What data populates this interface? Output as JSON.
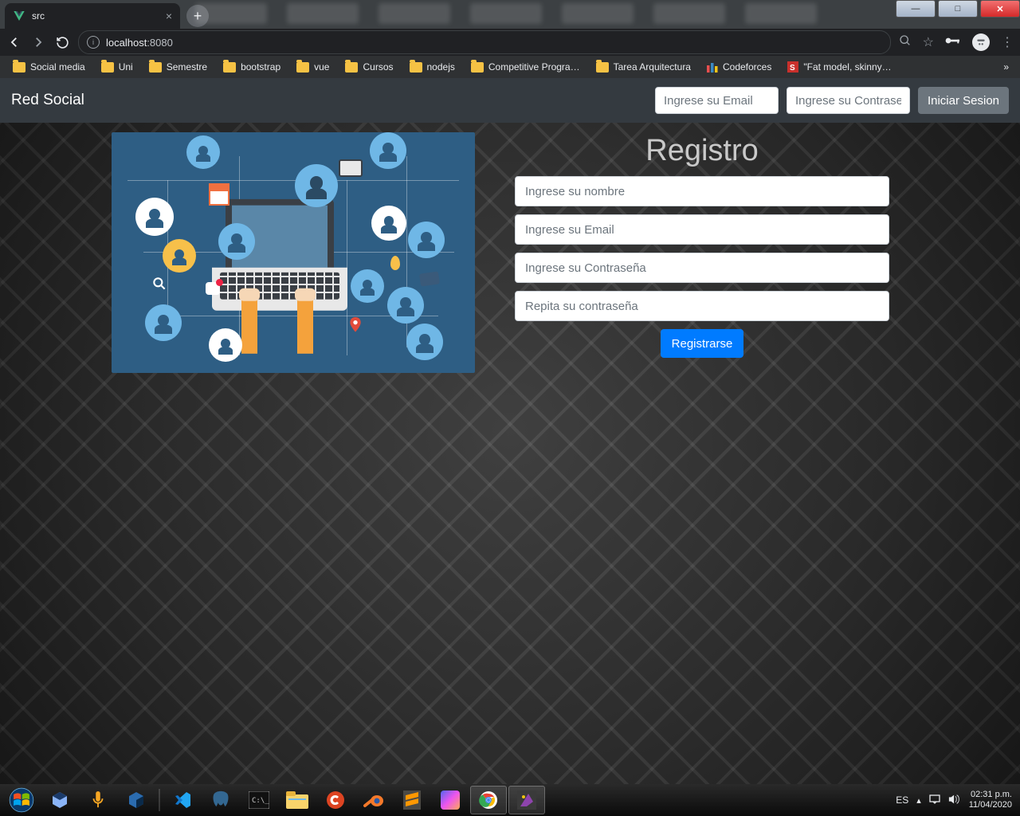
{
  "window_controls": {
    "min": "—",
    "max": "□",
    "close": "✕"
  },
  "browser": {
    "tab_title": "src",
    "url_host": "localhost",
    "url_port": ":8080",
    "bookmarks": [
      {
        "label": "Social media",
        "type": "folder"
      },
      {
        "label": "Uni",
        "type": "folder"
      },
      {
        "label": "Semestre",
        "type": "folder"
      },
      {
        "label": "bootstrap",
        "type": "folder"
      },
      {
        "label": "vue",
        "type": "folder"
      },
      {
        "label": "Cursos",
        "type": "folder"
      },
      {
        "label": "nodejs",
        "type": "folder"
      },
      {
        "label": "Competitive Progra…",
        "type": "folder"
      },
      {
        "label": "Tarea Arquitectura",
        "type": "folder"
      },
      {
        "label": "Codeforces",
        "type": "cf"
      },
      {
        "label": "\"Fat model, skinny…",
        "type": "so"
      }
    ]
  },
  "app": {
    "brand": "Red Social",
    "login": {
      "email_placeholder": "Ingrese su Email",
      "password_placeholder": "Ingrese su Contraseña",
      "submit_label": "Iniciar Sesion"
    },
    "register": {
      "title": "Registro",
      "name_placeholder": "Ingrese su nombre",
      "email_placeholder": "Ingrese su Email",
      "password_placeholder": "Ingrese su Contraseña",
      "repeat_placeholder": "Repita su contraseña",
      "submit_label": "Registrarse"
    }
  },
  "system": {
    "lang": "ES",
    "time": "02:31 p.m.",
    "date": "11/04/2020"
  }
}
